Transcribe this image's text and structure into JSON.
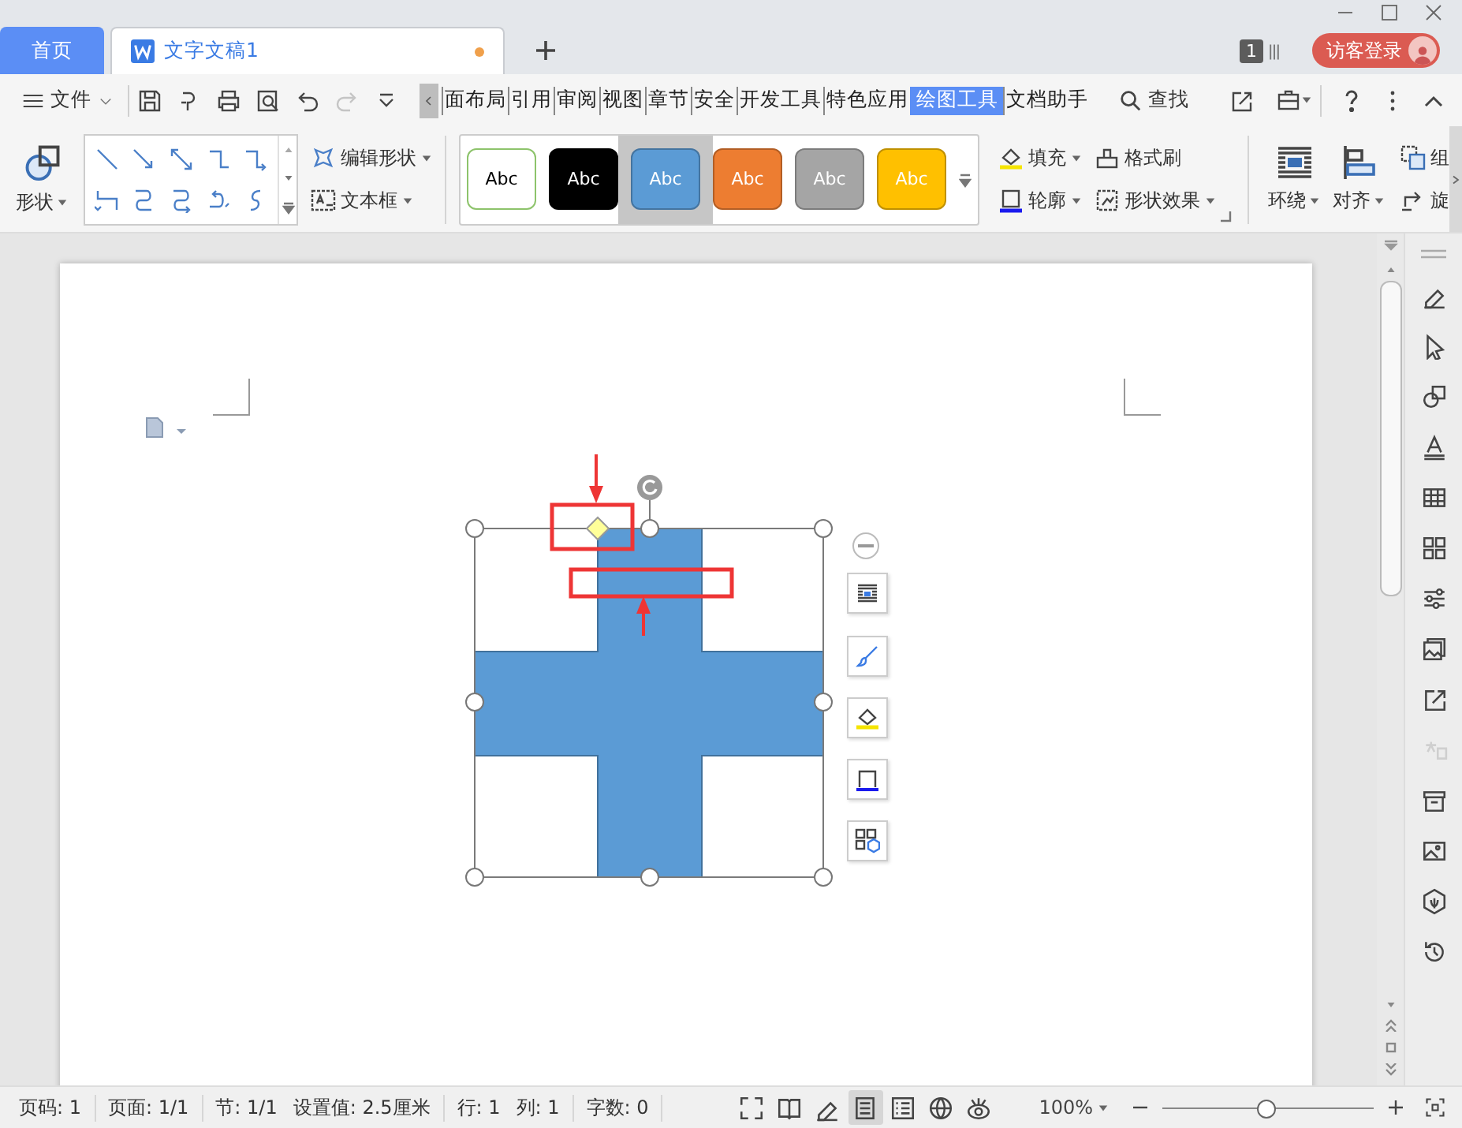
{
  "tabs": [
    {
      "label": "首页",
      "kind": "home",
      "selected": false,
      "unsaved": false
    },
    {
      "label": "文字文稿1",
      "kind": "document",
      "selected": true,
      "unsaved": true
    }
  ],
  "tab_count_badge": "1",
  "login_button": "访客登录",
  "menu": {
    "file": "文件",
    "quick_access": [
      {
        "kind": "save",
        "disabled": false
      },
      {
        "kind": "curve",
        "disabled": false
      },
      {
        "kind": "print",
        "disabled": false
      },
      {
        "kind": "preview",
        "disabled": false
      },
      {
        "kind": "undo",
        "disabled": false
      },
      {
        "kind": "redo",
        "disabled": true
      },
      {
        "kind": "more",
        "disabled": false
      }
    ],
    "ribbon_tabs": [
      {
        "label": "面布局",
        "selected": false
      },
      {
        "label": "引用",
        "selected": false
      },
      {
        "label": "审阅",
        "selected": false
      },
      {
        "label": "视图",
        "selected": false
      },
      {
        "label": "章节",
        "selected": false
      },
      {
        "label": "安全",
        "selected": false
      },
      {
        "label": "开发工具",
        "selected": false
      },
      {
        "label": "特色应用",
        "selected": false
      },
      {
        "label": "绘图工具",
        "selected": true
      },
      {
        "label": "文档助手",
        "selected": false
      }
    ],
    "search": "查找"
  },
  "ribbon": {
    "shape_button": "形状",
    "edit_shape": "编辑形状",
    "text_box": "文本框",
    "styles": [
      {
        "label": "Abc",
        "color": "#ffffff",
        "selected": false
      },
      {
        "label": "Abc",
        "color": "#000000",
        "selected": false
      },
      {
        "label": "Abc",
        "color": "#5b9bd5",
        "selected": true
      },
      {
        "label": "Abc",
        "color": "#ed7d31",
        "selected": false
      },
      {
        "label": "Abc",
        "color": "#a5a5a5",
        "selected": false
      },
      {
        "label": "Abc",
        "color": "#ffc000",
        "selected": false
      }
    ],
    "fill": "填充",
    "format_painter": "格式刷",
    "outline": "轮廓",
    "shape_effects": "形状效果",
    "wrap": "环绕",
    "align": "对齐",
    "group": "组",
    "rotate": "旋"
  },
  "sidebar": {
    "items": [
      {
        "kind": "pen",
        "disabled": false
      },
      {
        "kind": "cursor",
        "disabled": false
      },
      {
        "kind": "shapes",
        "disabled": false
      },
      {
        "kind": "textstyle",
        "disabled": false
      },
      {
        "kind": "table",
        "disabled": false
      },
      {
        "kind": "grid",
        "disabled": false
      },
      {
        "kind": "sliders",
        "disabled": false
      },
      {
        "kind": "images",
        "disabled": false
      },
      {
        "kind": "share",
        "disabled": false
      },
      {
        "kind": "translate",
        "disabled": true
      },
      {
        "kind": "archive",
        "disabled": false
      },
      {
        "kind": "picture",
        "disabled": false
      },
      {
        "kind": "hexagon",
        "disabled": false
      },
      {
        "kind": "history",
        "disabled": false
      }
    ]
  },
  "status_bar": {
    "groups": [
      [
        "页码: 1"
      ],
      [
        "页面: 1/1"
      ],
      [
        "节: 1/1",
        "设置值: 2.5厘米"
      ],
      [
        "行: 1",
        "列: 1"
      ],
      [
        "字数: 0"
      ]
    ],
    "view_modes": [
      {
        "kind": "fullscreen",
        "selected": false
      },
      {
        "kind": "reading",
        "selected": false
      },
      {
        "kind": "pen",
        "selected": false
      },
      {
        "kind": "page",
        "selected": true
      },
      {
        "kind": "outline",
        "selected": false
      },
      {
        "kind": "web",
        "selected": false
      },
      {
        "kind": "eye",
        "selected": false
      }
    ],
    "zoom": "100%",
    "zoom_slider": {
      "level": 0.49
    }
  }
}
